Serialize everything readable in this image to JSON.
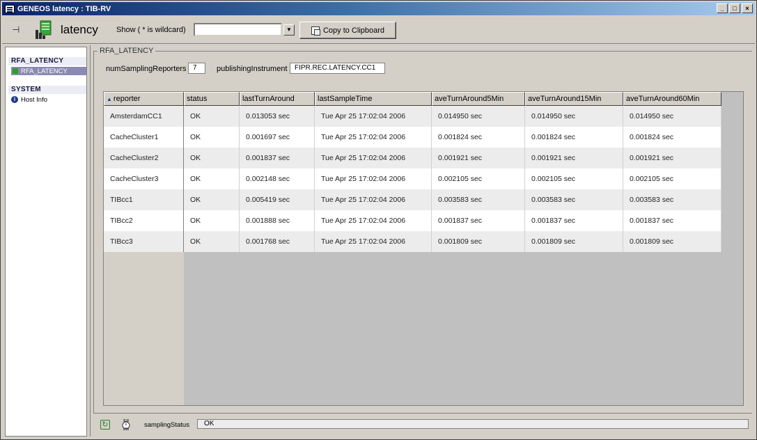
{
  "window": {
    "title": "GENEOS  latency : TIB-RV",
    "buttons": [
      "_",
      "□",
      "×"
    ]
  },
  "toolbar": {
    "title": "latency",
    "show_label": "Show ( * is wildcard)",
    "show_value": "",
    "copy_label": "Copy to Clipboard"
  },
  "tree": {
    "sections": [
      {
        "label": "RFA_LATENCY",
        "items": [
          {
            "label": "RFA_LATENCY",
            "icon": "green-square-icon",
            "selected": true
          }
        ]
      },
      {
        "label": "SYSTEM",
        "items": [
          {
            "label": "Host Info",
            "icon": "info-icon",
            "selected": false
          }
        ]
      }
    ]
  },
  "group": {
    "label": "RFA_LATENCY",
    "fields": [
      {
        "label": "numSamplingReporters",
        "value": "7"
      },
      {
        "label": "publishingInstrument",
        "value": "FIPR.REC.LATENCY.CC1"
      }
    ]
  },
  "table": {
    "sort_column": "reporter",
    "columns": [
      "reporter",
      "status",
      "lastTurnAround",
      "lastSampleTime",
      "aveTurnAround5Min",
      "aveTurnAround15Min",
      "aveTurnAround60Min"
    ],
    "rows": [
      [
        "AmsterdamCC1",
        "OK",
        "0.013053 sec",
        "Tue Apr 25 17:02:04 2006",
        "0.014950 sec",
        "0.014950 sec",
        "0.014950 sec"
      ],
      [
        "CacheCluster1",
        "OK",
        "0.001697 sec",
        "Tue Apr 25 17:02:04 2006",
        "0.001824 sec",
        "0.001824 sec",
        "0.001824 sec"
      ],
      [
        "CacheCluster2",
        "OK",
        "0.001837 sec",
        "Tue Apr 25 17:02:04 2006",
        "0.001921 sec",
        "0.001921 sec",
        "0.001921 sec"
      ],
      [
        "CacheCluster3",
        "OK",
        "0.002148 sec",
        "Tue Apr 25 17:02:04 2006",
        "0.002105 sec",
        "0.002105 sec",
        "0.002105 sec"
      ],
      [
        "TIBcc1",
        "OK",
        "0.005419 sec",
        "Tue Apr 25 17:02:04 2006",
        "0.003583 sec",
        "0.003583 sec",
        "0.003583 sec"
      ],
      [
        "TIBcc2",
        "OK",
        "0.001888 sec",
        "Tue Apr 25 17:02:04 2006",
        "0.001837 sec",
        "0.001837 sec",
        "0.001837 sec"
      ],
      [
        "TIBcc3",
        "OK",
        "0.001768 sec",
        "Tue Apr 25 17:02:04 2006",
        "0.001809 sec",
        "0.001809 sec",
        "0.001809 sec"
      ]
    ]
  },
  "status": {
    "label": "samplingStatus",
    "value": "OK"
  },
  "colors": {
    "title_bar": "#0a246a",
    "selected_tree_item": "#8a8ab4",
    "status_ok_icon": "#2e9c2e"
  }
}
